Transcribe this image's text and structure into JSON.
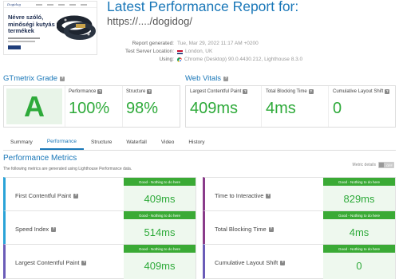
{
  "thumbnail": {
    "logo": "Dogidog",
    "headline": "Névre szóló, minőségi kutyás termékek"
  },
  "header": {
    "title": "Latest Performance Report for:",
    "url": "https://..../dogidog/"
  },
  "meta": {
    "generated_label": "Report generated:",
    "generated_value": "Tue, Mar 29, 2022 11:17 AM +0200",
    "server_label": "Test Server Location:",
    "server_value": "London, UK",
    "using_label": "Using:",
    "using_value": "Chrome (Desktop) 90.0.4430.212, Lighthouse 8.3.0"
  },
  "grade": {
    "title": "GTmetrix Grade",
    "letter": "A",
    "performance_label": "Performance",
    "performance_value": "100%",
    "structure_label": "Structure",
    "structure_value": "98%",
    "color": "#2eaa3a"
  },
  "vitals": {
    "title": "Web Vitals",
    "lcp_label": "Largest Contentful Paint",
    "lcp_value": "409ms",
    "tbt_label": "Total Blocking Time",
    "tbt_value": "4ms",
    "cls_label": "Cumulative Layout Shift",
    "cls_value": "0"
  },
  "tabs": {
    "summary": "Summary",
    "performance": "Performance",
    "structure": "Structure",
    "waterfall": "Waterfall",
    "video": "Video",
    "history": "History"
  },
  "metrics": {
    "title": "Performance Metrics",
    "description": "The following metrics are generated using Lighthouse Performance data.",
    "details_label": "Metric details",
    "details_toggle": "OFF",
    "badge_text": "Good - Nothing to do here",
    "items": [
      {
        "label": "First Contentful Paint",
        "value": "409ms"
      },
      {
        "label": "Time to Interactive",
        "value": "829ms"
      },
      {
        "label": "Speed Index",
        "value": "514ms"
      },
      {
        "label": "Total Blocking Time",
        "value": "4ms"
      },
      {
        "label": "Largest Contentful Paint",
        "value": "409ms"
      },
      {
        "label": "Cumulative Layout Shift",
        "value": "0"
      }
    ]
  },
  "colors": {
    "accent": "#1977b8",
    "good": "#3aaa35",
    "fcp_border": "#2aa3d8",
    "tti_border": "#8a3c8a",
    "tbt_border": "#8a3c8a",
    "cls_border": "#6b5cb8"
  }
}
